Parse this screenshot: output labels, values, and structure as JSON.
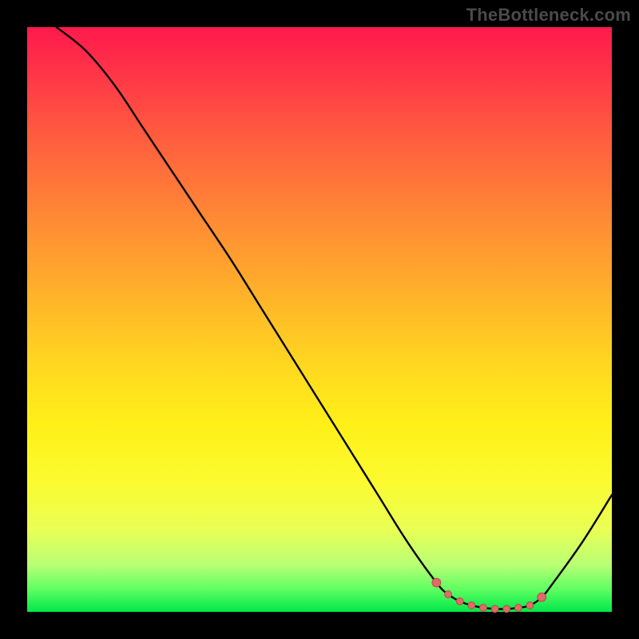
{
  "watermark": "TheBottleneck.com",
  "colors": {
    "background": "#000000",
    "curve": "#000000",
    "marker": "#e06a6a",
    "marker_stroke": "#c14747"
  },
  "chart_data": {
    "type": "line",
    "title": "",
    "xlabel": "",
    "ylabel": "",
    "xlim": [
      0,
      100
    ],
    "ylim": [
      0,
      100
    ],
    "x": [
      5,
      10,
      15,
      20,
      25,
      30,
      35,
      40,
      45,
      50,
      55,
      60,
      65,
      70,
      72,
      74,
      76,
      78,
      80,
      82,
      84,
      86,
      88,
      90,
      95,
      100
    ],
    "values": [
      100,
      96,
      90,
      82.5,
      75,
      67.5,
      60,
      52,
      44,
      36,
      28,
      20,
      12,
      5,
      3,
      1.8,
      1.1,
      0.7,
      0.5,
      0.5,
      0.7,
      1.1,
      2.5,
      5,
      12,
      20
    ],
    "markers": {
      "x": [
        70,
        72,
        74,
        76,
        78,
        80,
        82,
        84,
        86,
        88
      ],
      "values": [
        5,
        3,
        1.8,
        1.1,
        0.7,
        0.5,
        0.5,
        0.7,
        1.1,
        2.5
      ]
    },
    "annotations": []
  }
}
